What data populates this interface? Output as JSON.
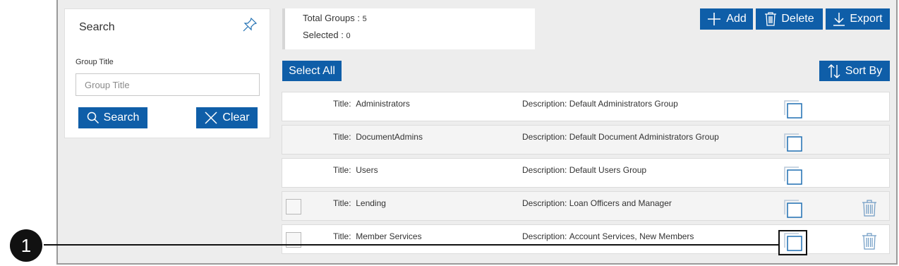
{
  "search_panel": {
    "title": "Search",
    "field_label": "Group Title",
    "field_placeholder": "Group Title",
    "field_value": "",
    "search_label": "Search",
    "clear_label": "Clear"
  },
  "summary": {
    "total_label": "Total Groups :",
    "total_value": "5",
    "selected_label": "Selected :",
    "selected_value": "0"
  },
  "toolbar": {
    "add_label": "Add",
    "delete_label": "Delete",
    "export_label": "Export",
    "select_all_label": "Select All",
    "sort_label": "Sort By"
  },
  "rows": [
    {
      "title_label": "Title:",
      "title": "Administrators",
      "desc_label": "Description:",
      "description": "Default Administrators Group"
    },
    {
      "title_label": "Title:",
      "title": "DocumentAdmins",
      "desc_label": "Description:",
      "description": "Default Document Administrators Group"
    },
    {
      "title_label": "Title:",
      "title": "Users",
      "desc_label": "Description:",
      "description": "Default Users Group"
    },
    {
      "title_label": "Title:",
      "title": "Lending",
      "desc_label": "Description:",
      "description": "Loan Officers and Manager"
    },
    {
      "title_label": "Title:",
      "title": "Member Services",
      "desc_label": "Description:",
      "description": "Account Services, New Members"
    }
  ],
  "callout": {
    "number": "1"
  },
  "colors": {
    "accent": "#0f5ea8",
    "background": "#ededed",
    "panel": "#ffffff",
    "icon_blue": "#1f6fb2"
  }
}
